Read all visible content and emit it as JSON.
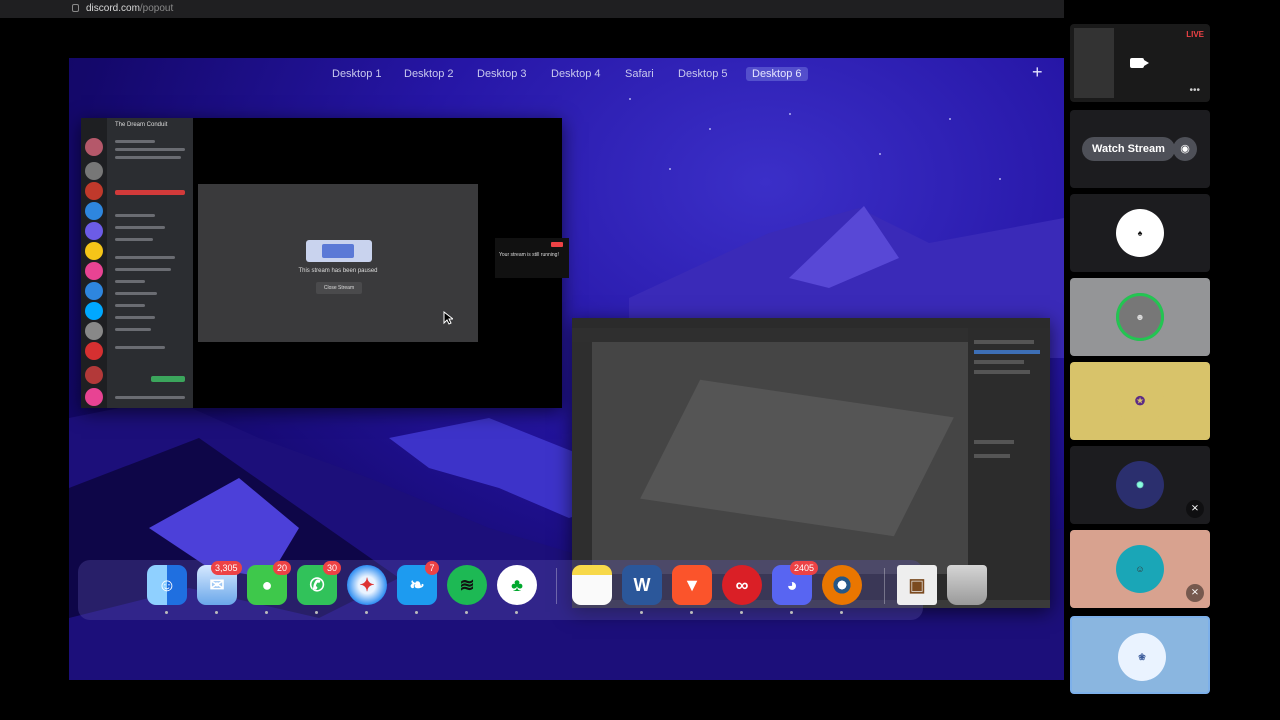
{
  "browser": {
    "domain": "discord.com",
    "path": "/popout"
  },
  "spaces": {
    "items": [
      {
        "label": "Desktop 1"
      },
      {
        "label": "Desktop 2"
      },
      {
        "label": "Desktop 3"
      },
      {
        "label": "Desktop 4"
      },
      {
        "label": "Safari"
      },
      {
        "label": "Desktop 5"
      },
      {
        "label": "Desktop 6",
        "active": true
      }
    ],
    "add_label": "+"
  },
  "discord_window": {
    "server_name": "The Dream Conduit",
    "modal_text": "This stream has been paused",
    "modal_button": "Close Stream",
    "mini_text": "Your stream is still running!"
  },
  "dock": {
    "apps": [
      {
        "name": "finder",
        "badge": ""
      },
      {
        "name": "mail",
        "badge": "3,305"
      },
      {
        "name": "messages",
        "badge": "20"
      },
      {
        "name": "whatsapp",
        "badge": "30"
      },
      {
        "name": "safari",
        "badge": ""
      },
      {
        "name": "twitter",
        "badge": "7"
      },
      {
        "name": "spotify",
        "badge": ""
      },
      {
        "name": "evernote",
        "badge": ""
      },
      {
        "name": "notes",
        "badge": ""
      },
      {
        "name": "word",
        "badge": ""
      },
      {
        "name": "brave",
        "badge": ""
      },
      {
        "name": "creative-cloud",
        "badge": ""
      },
      {
        "name": "discord",
        "badge": "2405"
      },
      {
        "name": "blender",
        "badge": ""
      },
      {
        "name": "preview",
        "badge": ""
      },
      {
        "name": "trash",
        "badge": ""
      }
    ]
  },
  "panel": {
    "live_label": "LIVE",
    "watch_stream_label": "Watch Stream",
    "more_label": "•••",
    "tiles": [
      {
        "name": "participant-1"
      },
      {
        "name": "participant-2"
      },
      {
        "name": "participant-3"
      },
      {
        "name": "participant-4",
        "muted": true
      },
      {
        "name": "participant-5",
        "muted": true
      },
      {
        "name": "participant-6"
      }
    ]
  },
  "colors": {
    "wallpaper": "#2616a6",
    "badge": "#ed4245",
    "watch_button": "#4e5058",
    "panel_bg": "#000000"
  }
}
